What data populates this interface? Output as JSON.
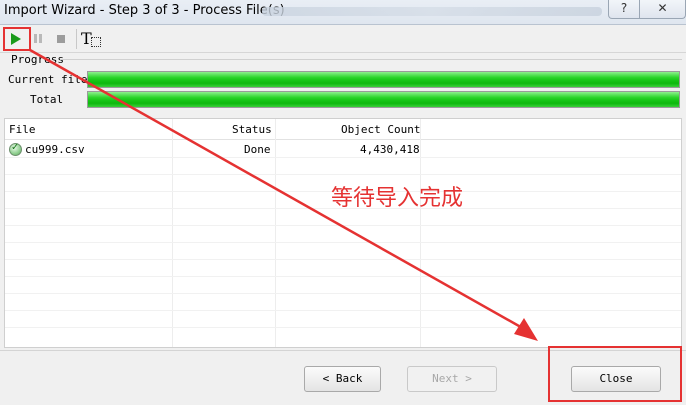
{
  "window": {
    "title": "Import Wizard - Step 3 of 3 - Process File(s)",
    "help_label": "?",
    "close_label": "✕"
  },
  "toolbar": {
    "text_tool_label": "T"
  },
  "progress": {
    "section_title": "Progress",
    "current_label": "Current file",
    "current_value": 1.0,
    "total_label": "Total",
    "total_value": 1.0
  },
  "table": {
    "columns": [
      "File",
      "Status",
      "Object Count"
    ],
    "rows": [
      {
        "file": "cu999.csv",
        "status": "Done",
        "count": "4,430,418"
      }
    ]
  },
  "annotation": {
    "text": "等待导入完成",
    "color": "#e53232"
  },
  "footer": {
    "back_label": "< Back",
    "next_label": "Next >",
    "close_label": "Close"
  },
  "colors": {
    "progress_green": "#17c617",
    "highlight_red": "#e53232"
  },
  "icons": {
    "play": "play-icon",
    "pause": "pause-icon",
    "stop": "stop-icon",
    "text": "text-tool-icon",
    "file": "file-done-icon"
  }
}
